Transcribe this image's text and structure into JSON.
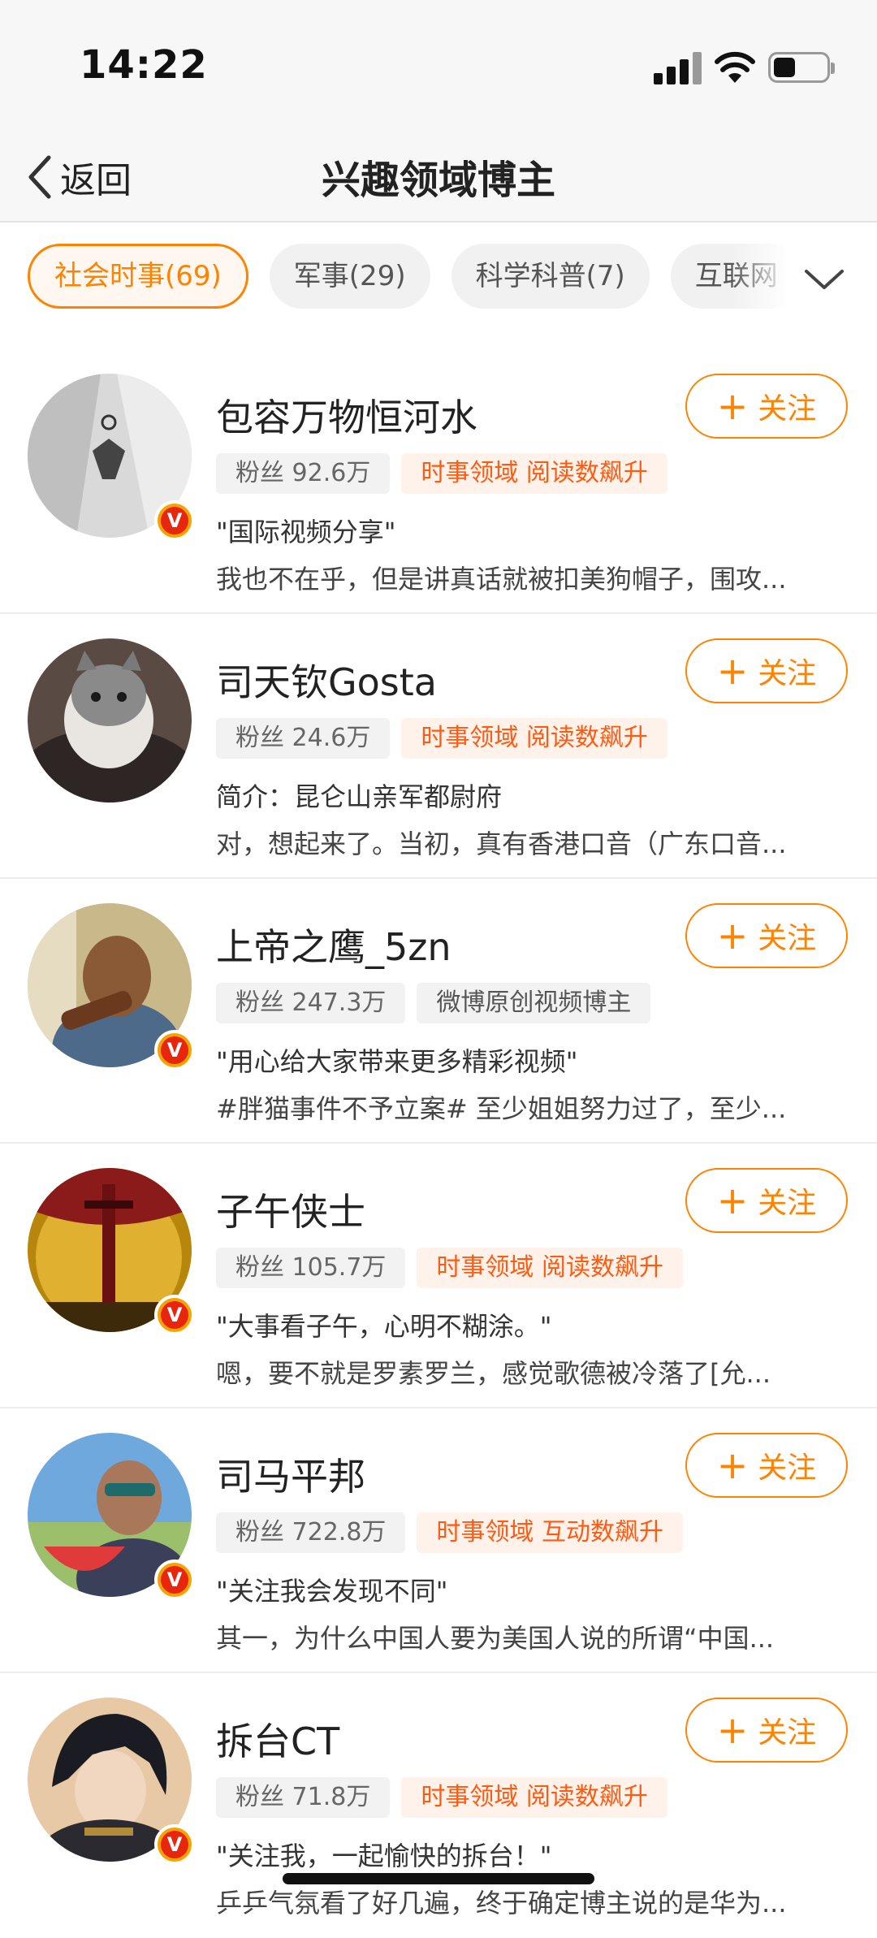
{
  "status": {
    "time": "14:22"
  },
  "nav": {
    "back_label": "返回",
    "title": "兴趣领域博主"
  },
  "filters": [
    {
      "label": "社会时事(69)",
      "active": true
    },
    {
      "label": "军事(29)",
      "active": false
    },
    {
      "label": "科学科普(7)",
      "active": false
    },
    {
      "label": "互联网",
      "active": false
    }
  ],
  "follow_label": "关注",
  "users": [
    {
      "name": "包容万物恒河水",
      "fans": "粉丝 92.6万",
      "tag": "时事领域 阅读数飙升",
      "tag_style": "domain",
      "desc": "\"国际视频分享\"",
      "post": "我也不在乎，但是讲真话就被扣美狗帽子，围攻...",
      "verified": true
    },
    {
      "name": "司天钦Gosta",
      "fans": "粉丝 24.6万",
      "tag": "时事领域 阅读数飙升",
      "tag_style": "domain",
      "desc": "简介：昆仑山亲军都尉府",
      "post": "对，想起来了。当初，真有香港口音（广东口音...",
      "verified": false
    },
    {
      "name": "上帝之鹰_5zn",
      "fans": "粉丝 247.3万",
      "tag": "微博原创视频博主",
      "tag_style": "neutral",
      "desc": "\"用心给大家带来更多精彩视频\"",
      "post": "#胖猫事件不予立案# 至少姐姐努力过了，至少...",
      "verified": true
    },
    {
      "name": "子午侠士",
      "fans": "粉丝 105.7万",
      "tag": "时事领域 阅读数飙升",
      "tag_style": "domain",
      "desc": "\"大事看子午，心明不糊涂。\"",
      "post": "嗯，要不就是罗素罗兰，感觉歌德被冷落了[允...",
      "verified": true
    },
    {
      "name": "司马平邦",
      "fans": "粉丝 722.8万",
      "tag": "时事领域 互动数飙升",
      "tag_style": "domain",
      "desc": "\"关注我会发现不同\"",
      "post": "其一，为什么中国人要为美国人说的所谓“中国...",
      "verified": true
    },
    {
      "name": "拆台CT",
      "fans": "粉丝 71.8万",
      "tag": "时事领域 阅读数飙升",
      "tag_style": "domain",
      "desc": "\"关注我，一起愉快的拆台！\"",
      "post": "乒乒气氛看了好几遍，终于确定博主说的是华为...",
      "verified": true
    }
  ]
}
